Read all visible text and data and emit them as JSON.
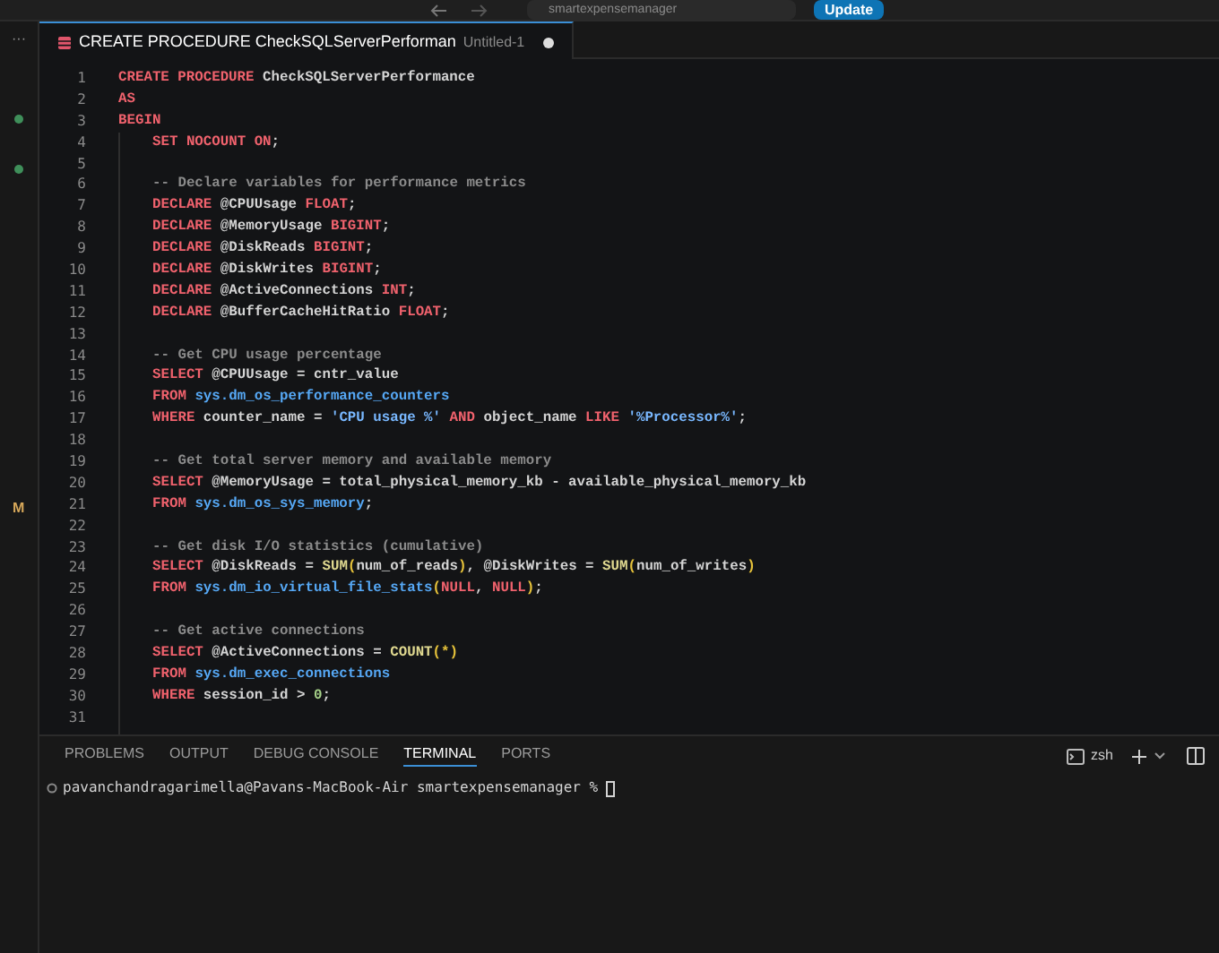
{
  "title_bar": {
    "search": "smartexpensemanager",
    "update_button": "Update"
  },
  "activity_bar": {
    "more": "···",
    "items": [
      {
        "kind": "dot",
        "color": "#3f8f5a"
      },
      {
        "kind": "dot",
        "color": "#3f8f5a"
      },
      {
        "kind": "letter",
        "text": "M",
        "color": "#d7a85a"
      }
    ]
  },
  "tabs": [
    {
      "title": "CREATE PROCEDURE CheckSQLServerPerforman",
      "description": "Untitled-1",
      "dirty": true,
      "selected": true
    }
  ],
  "editor": {
    "lines": [
      {
        "number": "1",
        "tokens": [
          {
            "kind": "kw",
            "text": "CREATE PROCEDURE "
          },
          {
            "kind": "id",
            "text": "CheckSQLServerPerformance"
          }
        ]
      },
      {
        "number": "2",
        "tokens": [
          {
            "kind": "kw",
            "text": "AS"
          }
        ]
      },
      {
        "number": "3",
        "tokens": [
          {
            "kind": "kw",
            "text": "BEGIN"
          }
        ],
        "children": [
          {
            "number": "4",
            "tokens": [
              {
                "kind": "kw",
                "text": "SET NOCOUNT ON"
              },
              {
                "kind": "id",
                "text": ";"
              }
            ]
          },
          {
            "number": "5"
          },
          {
            "number": "6",
            "tokens": [
              {
                "kind": "cmt",
                "text": "-- Declare variables for performance metrics"
              }
            ]
          },
          {
            "number": "7",
            "tokens": [
              {
                "kind": "kw",
                "text": "DECLARE"
              },
              {
                "kind": "id",
                "text": " @CPUUsage "
              },
              {
                "kind": "kw",
                "text": "FLOAT"
              },
              {
                "kind": "id",
                "text": ";"
              }
            ]
          },
          {
            "number": "8",
            "tokens": [
              {
                "kind": "kw",
                "text": "DECLARE"
              },
              {
                "kind": "id",
                "text": " @MemoryUsage "
              },
              {
                "kind": "kw",
                "text": "BIGINT"
              },
              {
                "kind": "id",
                "text": ";"
              }
            ]
          },
          {
            "number": "9",
            "tokens": [
              {
                "kind": "kw",
                "text": "DECLARE"
              },
              {
                "kind": "id",
                "text": " @DiskReads "
              },
              {
                "kind": "kw",
                "text": "BIGINT"
              },
              {
                "kind": "id",
                "text": ";"
              }
            ]
          },
          {
            "number": "10",
            "tokens": [
              {
                "kind": "kw",
                "text": "DECLARE"
              },
              {
                "kind": "id",
                "text": " @DiskWrites "
              },
              {
                "kind": "kw",
                "text": "BIGINT"
              },
              {
                "kind": "id",
                "text": ";"
              }
            ]
          },
          {
            "number": "11",
            "tokens": [
              {
                "kind": "kw",
                "text": "DECLARE"
              },
              {
                "kind": "id",
                "text": " @ActiveConnections "
              },
              {
                "kind": "kw",
                "text": "INT"
              },
              {
                "kind": "id",
                "text": ";"
              }
            ]
          },
          {
            "number": "12",
            "tokens": [
              {
                "kind": "kw",
                "text": "DECLARE"
              },
              {
                "kind": "id",
                "text": " @BufferCacheHitRatio "
              },
              {
                "kind": "kw",
                "text": "FLOAT"
              },
              {
                "kind": "id",
                "text": ";"
              }
            ]
          },
          {
            "number": "13"
          },
          {
            "number": "14",
            "tokens": [
              {
                "kind": "cmt",
                "text": "-- Get CPU usage percentage"
              }
            ]
          },
          {
            "number": "15",
            "tokens": [
              {
                "kind": "kw",
                "text": "SELECT"
              },
              {
                "kind": "id",
                "text": " @CPUUsage = cntr_value"
              }
            ]
          },
          {
            "number": "16",
            "tokens": [
              {
                "kind": "kw",
                "text": "FROM "
              },
              {
                "kind": "obj",
                "text": "sys.dm_os_performance_counters"
              }
            ]
          },
          {
            "number": "17",
            "tokens": [
              {
                "kind": "kw",
                "text": "WHERE"
              },
              {
                "kind": "id",
                "text": " counter_name = "
              },
              {
                "kind": "str",
                "text": "'CPU usage %'"
              },
              {
                "kind": "kw",
                "text": " AND"
              },
              {
                "kind": "id",
                "text": " object_name "
              },
              {
                "kind": "kw",
                "text": "LIKE "
              },
              {
                "kind": "str",
                "text": "'%Processor%'"
              },
              {
                "kind": "id",
                "text": ";"
              }
            ]
          },
          {
            "number": "18"
          },
          {
            "number": "19",
            "tokens": [
              {
                "kind": "cmt",
                "text": "-- Get total server memory and available memory"
              }
            ]
          },
          {
            "number": "20",
            "tokens": [
              {
                "kind": "kw",
                "text": "SELECT"
              },
              {
                "kind": "id",
                "text": " @MemoryUsage = total_physical_memory_kb - available_physical_memory_kb"
              }
            ]
          },
          {
            "number": "21",
            "tokens": [
              {
                "kind": "kw",
                "text": "FROM "
              },
              {
                "kind": "obj",
                "text": "sys.dm_os_sys_memory"
              },
              {
                "kind": "id",
                "text": ";"
              }
            ]
          },
          {
            "number": "22"
          },
          {
            "number": "23",
            "tokens": [
              {
                "kind": "cmt",
                "text": "-- Get disk I/O statistics (cumulative)"
              }
            ]
          },
          {
            "number": "24",
            "tokens": [
              {
                "kind": "kw",
                "text": "SELECT"
              },
              {
                "kind": "id",
                "text": " @DiskReads = "
              },
              {
                "kind": "fn",
                "text": "SUM"
              },
              {
                "kind": "paren",
                "text": "("
              },
              {
                "kind": "id",
                "text": "num_of_reads"
              },
              {
                "kind": "paren",
                "text": ")"
              },
              {
                "kind": "id",
                "text": ", @DiskWrites = "
              },
              {
                "kind": "fn",
                "text": "SUM"
              },
              {
                "kind": "paren",
                "text": "("
              },
              {
                "kind": "id",
                "text": "num_of_writes"
              },
              {
                "kind": "paren",
                "text": ")"
              }
            ]
          },
          {
            "number": "25",
            "tokens": [
              {
                "kind": "kw",
                "text": "FROM "
              },
              {
                "kind": "obj",
                "text": "sys.dm_io_virtual_file_stats"
              },
              {
                "kind": "paren",
                "text": "("
              },
              {
                "kind": "kw",
                "text": "NULL"
              },
              {
                "kind": "id",
                "text": ", "
              },
              {
                "kind": "kw",
                "text": "NULL"
              },
              {
                "kind": "paren",
                "text": ")"
              },
              {
                "kind": "id",
                "text": ";"
              }
            ]
          },
          {
            "number": "26"
          },
          {
            "number": "27",
            "tokens": [
              {
                "kind": "cmt",
                "text": "-- Get active connections"
              }
            ]
          },
          {
            "number": "28",
            "tokens": [
              {
                "kind": "kw",
                "text": "SELECT"
              },
              {
                "kind": "id",
                "text": " @ActiveConnections = "
              },
              {
                "kind": "fn",
                "text": "COUNT"
              },
              {
                "kind": "paren",
                "text": "(*)"
              }
            ]
          },
          {
            "number": "29",
            "tokens": [
              {
                "kind": "kw",
                "text": "FROM "
              },
              {
                "kind": "obj",
                "text": "sys.dm_exec_connections"
              }
            ]
          },
          {
            "number": "30",
            "tokens": [
              {
                "kind": "kw",
                "text": "WHERE"
              },
              {
                "kind": "id",
                "text": " session_id > "
              },
              {
                "kind": "num",
                "text": "0"
              },
              {
                "kind": "id",
                "text": ";"
              }
            ]
          },
          {
            "number": "31"
          }
        ]
      }
    ]
  },
  "panel": {
    "tabs": [
      {
        "label": "PROBLEMS",
        "selected": false
      },
      {
        "label": "OUTPUT",
        "selected": false
      },
      {
        "label": "DEBUG CONSOLE",
        "selected": false
      },
      {
        "label": "TERMINAL",
        "selected": true
      },
      {
        "label": "PORTS",
        "selected": false
      }
    ],
    "shell": "zsh",
    "terminal": {
      "prompt": "pavanchandragarimella@Pavans-MacBook-Air smartexpensemanager %"
    }
  }
}
